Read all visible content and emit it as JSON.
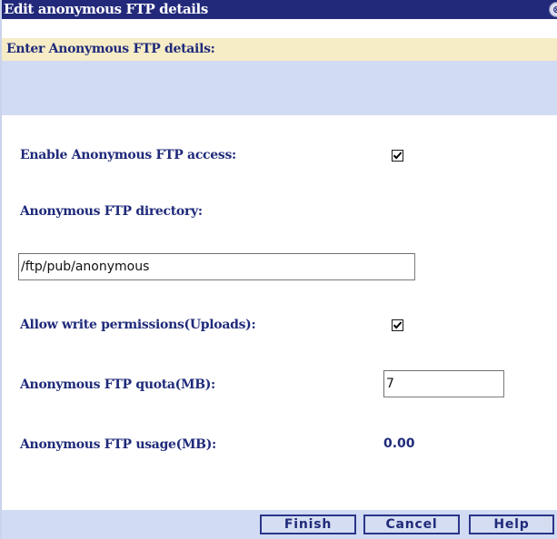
{
  "dialog": {
    "title": "Edit anonymous FTP details",
    "close_glyph": "⊗"
  },
  "section": {
    "header": "Enter Anonymous FTP details:"
  },
  "form": {
    "enable_label": "Enable Anonymous FTP access:",
    "enable_checked": true,
    "directory_label": "Anonymous FTP directory:",
    "directory_value": "/ftp/pub/anonymous",
    "write_label": "Allow write permissions(Uploads):",
    "write_checked": true,
    "quota_label": "Anonymous FTP quota(MB):",
    "quota_value": "7",
    "usage_label": "Anonymous FTP usage(MB):",
    "usage_value": "0.00"
  },
  "buttons": {
    "finish": "Finish",
    "cancel": "Cancel",
    "help": "Help"
  },
  "colors": {
    "titlebar": "#22297a",
    "section_header_bg": "#f6ecc6",
    "band_bg": "#d2dbf4",
    "label_text": "#1f2a7a"
  }
}
